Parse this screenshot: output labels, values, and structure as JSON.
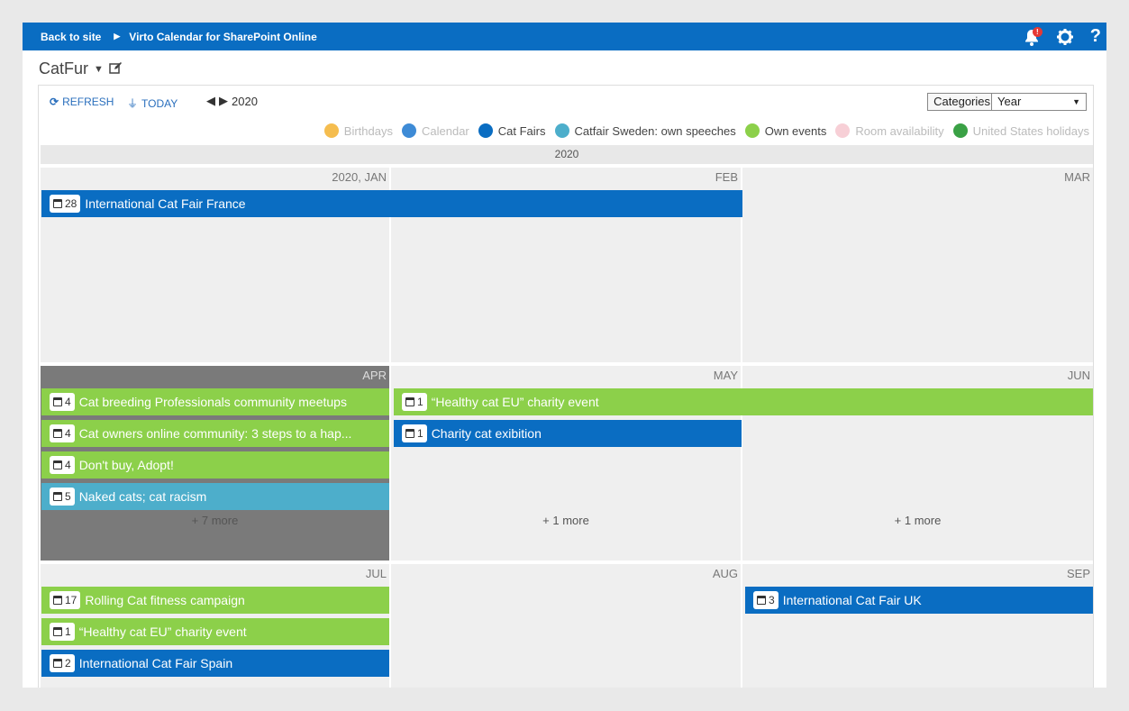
{
  "topbar": {
    "back": "Back to site",
    "app": "Virto Calendar for SharePoint Online",
    "notif_badge": "!",
    "help": "?"
  },
  "calendar": {
    "name": "CatFur"
  },
  "toolbar": {
    "refresh": "REFRESH",
    "today": "TODAY",
    "year": "2020",
    "categories": "Categories",
    "view": "Year"
  },
  "legend": [
    {
      "label": "Birthdays",
      "color": "#f5bd4f",
      "active": false
    },
    {
      "label": "Calendar",
      "color": "#3e8bd6",
      "active": false
    },
    {
      "label": "Cat Fairs",
      "color": "#0a6dc2",
      "active": true
    },
    {
      "label": "Catfair Sweden: own speeches",
      "color": "#4daecb",
      "active": true
    },
    {
      "label": "Own events",
      "color": "#8cd04a",
      "active": true
    },
    {
      "label": "Room availability",
      "color": "#f7cfd6",
      "active": false
    },
    {
      "label": "United States holidays",
      "color": "#3aa145",
      "active": false
    }
  ],
  "year_band": "2020",
  "months": {
    "jan": "2020, JAN",
    "feb": "FEB",
    "mar": "MAR",
    "apr": "APR",
    "may": "MAY",
    "jun": "JUN",
    "jul": "JUL",
    "aug": "AUG",
    "sep": "SEP"
  },
  "more": {
    "apr": "+ 7 more",
    "may": "+ 1 more",
    "jun": "+ 1 more"
  },
  "events": {
    "e1": {
      "day": "28",
      "title": "International Cat Fair France"
    },
    "e2": {
      "day": "4",
      "title": "Cat breeding Professionals community meetups"
    },
    "e3": {
      "day": "4",
      "title": "Cat owners online community: 3 steps to a hap..."
    },
    "e4": {
      "day": "4",
      "title": "Don't buy, Adopt!"
    },
    "e5": {
      "day": "5",
      "title": "Naked cats; cat racism"
    },
    "e6": {
      "day": "1",
      "title": "“Healthy cat EU” charity event"
    },
    "e7": {
      "day": "1",
      "title": "Charity cat exibition"
    },
    "e8": {
      "day": "17",
      "title": "Rolling Cat fitness campaign"
    },
    "e9": {
      "day": "1",
      "title": "“Healthy cat EU” charity event"
    },
    "e10": {
      "day": "2",
      "title": "International Cat Fair Spain"
    },
    "e11": {
      "day": "3",
      "title": "International Cat Fair UK"
    }
  }
}
